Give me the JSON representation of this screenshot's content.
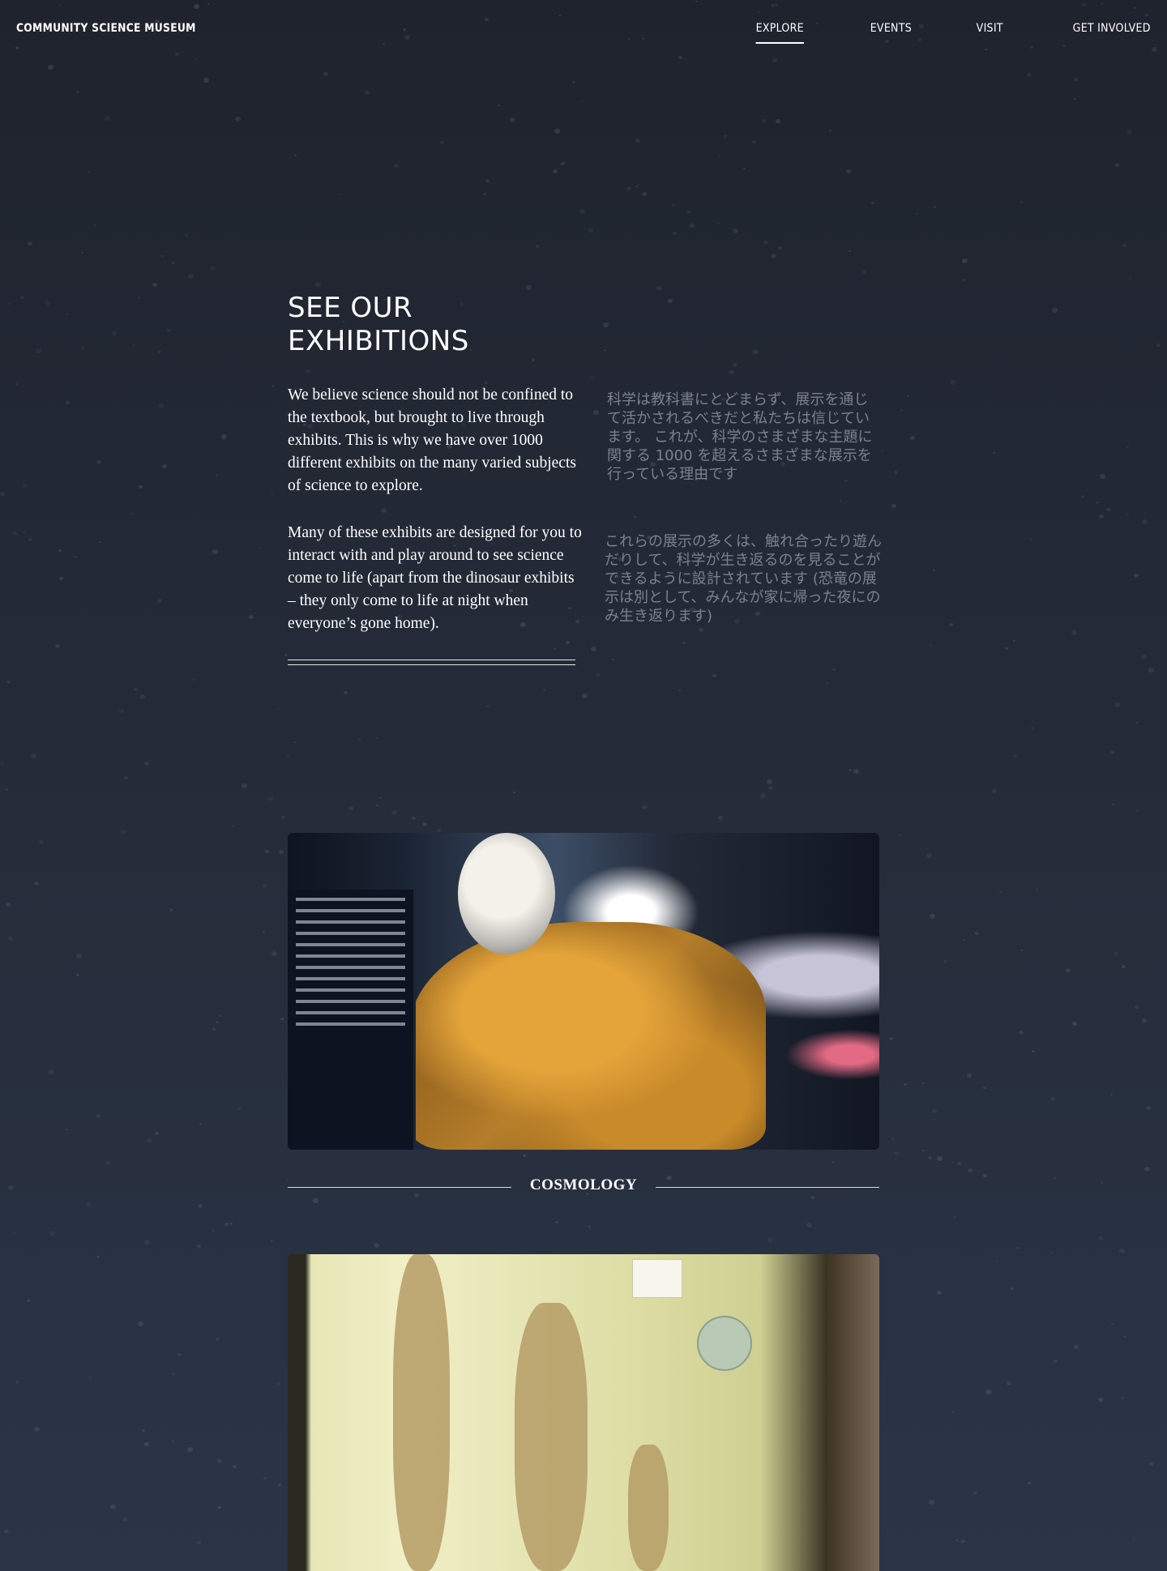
{
  "site": {
    "name": "COMMUNITY SCIENCE MUSEUM"
  },
  "nav": {
    "items": [
      {
        "label": "EXPLORE",
        "active": true
      },
      {
        "label": "EVENTS",
        "active": false
      },
      {
        "label": "VISIT",
        "active": false
      },
      {
        "label": "GET INVOLVED",
        "active": false
      }
    ]
  },
  "intro": {
    "title": "SEE OUR EXHIBITIONS",
    "paragraphs_en": [
      "We believe science should not be confined to the textbook, but brought to live through exhibits. This is why we have over 1000 different exhibits on the many varied subjects of science to explore.",
      "Many of these exhibits are designed for you to interact with and play around to see science come to life (apart from the dinosaur exhibits – they only come to life at night when everyone’s gone home)."
    ],
    "paragraphs_jp": [
      "科学は教科書にとどまらず、展示を通じて活かされるべきだと私たちは信じています。 これが、科学のさまざまな主題に関する 1000 を超えるさまざまな展示を行っている理由です",
      "これらの展示の多くは、触れ合ったり遊んだりして、科学が生き返るのを見ることができるように設計されています (恐竜の展示は別として、みんなが家に帰った夜にのみ生き返ります)"
    ]
  },
  "exhibitions": [
    {
      "caption": "COSMOLOGY"
    }
  ],
  "colors": {
    "background_top": "#1f232d",
    "background_bottom": "#2b3547",
    "text": "#ffffff",
    "jp_text": "#7b8190"
  }
}
